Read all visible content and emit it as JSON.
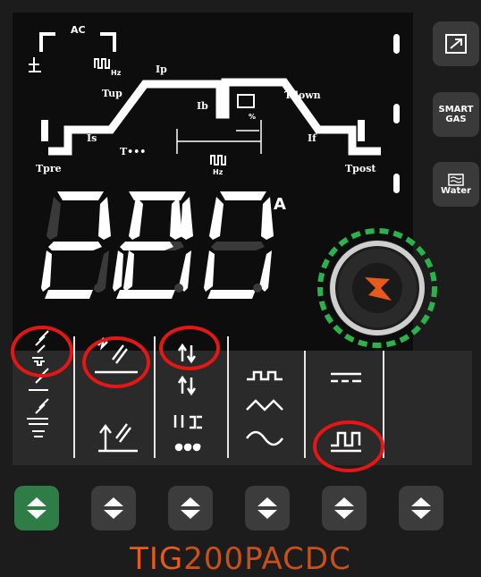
{
  "process": {
    "ac_label": "AC",
    "hz_label": "Hz",
    "hz_label_2": "Hz",
    "percent_label": "%",
    "t_pre": "Tpre",
    "i_s": "Is",
    "t_up": "Tup",
    "t_dots": "T•••",
    "i_p": "Ip",
    "i_b": "Ib",
    "t_down": "Tdown",
    "i_f": "If",
    "t_post": "Tpost"
  },
  "display": {
    "value": "200",
    "unit": "A"
  },
  "side_buttons": {
    "smart_gas_line1": "SMART",
    "smart_gas_line2": "GAS",
    "water_label": "Water"
  },
  "mode_section": {
    "dots": "•••"
  },
  "brand": {
    "tig": "TIG",
    "model": "200PACDC"
  },
  "colors": {
    "accent_orange": "#e85a1b",
    "highlight_red": "#e41616",
    "active_green": "#2e7d46",
    "knob_ring_green": "#2bb24c"
  }
}
